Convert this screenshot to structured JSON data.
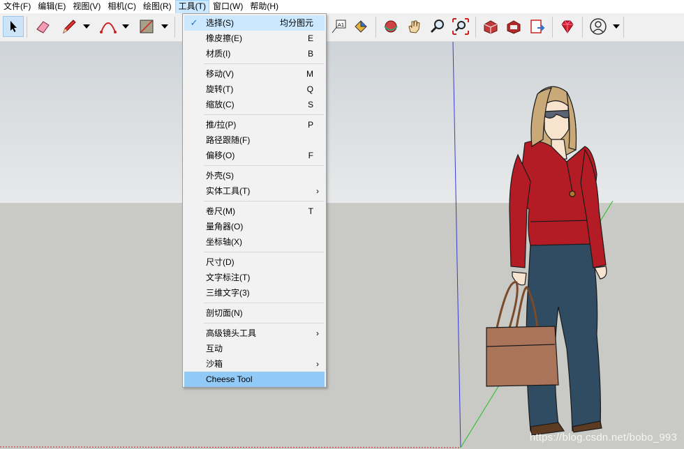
{
  "menubar": {
    "items": [
      {
        "label": "文件(F)"
      },
      {
        "label": "编辑(E)"
      },
      {
        "label": "视图(V)"
      },
      {
        "label": "相机(C)"
      },
      {
        "label": "绘图(R)"
      },
      {
        "label": "工具(T)",
        "active": true
      },
      {
        "label": "窗口(W)"
      },
      {
        "label": "帮助(H)"
      }
    ]
  },
  "toolbar": {
    "icons": [
      "select-arrow-icon",
      "eraser-icon",
      "pencil-icon",
      "arc-icon",
      "rectangle-icon",
      "text-label-icon",
      "paint-bucket-icon",
      "orbit-icon",
      "pan-hand-icon",
      "zoom-magnifier-icon",
      "zoom-extents-icon",
      "warehouse-icon",
      "extension-warehouse-icon",
      "send-to-layout-icon",
      "ruby-icon",
      "account-icon"
    ]
  },
  "tools_menu": {
    "items": [
      {
        "label": "选择(S)",
        "shortcut": "均分图元",
        "checked": true
      },
      {
        "label": "橡皮擦(E)",
        "shortcut": "E"
      },
      {
        "label": "材质(I)",
        "shortcut": "B"
      },
      {
        "label": "移动(V)",
        "shortcut": "M"
      },
      {
        "label": "旋转(T)",
        "shortcut": "Q"
      },
      {
        "label": "缩放(C)",
        "shortcut": "S"
      },
      {
        "label": "推/拉(P)",
        "shortcut": "P"
      },
      {
        "label": "路径跟随(F)",
        "shortcut": ""
      },
      {
        "label": "偏移(O)",
        "shortcut": "F"
      },
      {
        "label": "外壳(S)",
        "shortcut": ""
      },
      {
        "label": "实体工具(T)",
        "shortcut": "",
        "submenu": true
      },
      {
        "label": "卷尺(M)",
        "shortcut": "T"
      },
      {
        "label": "量角器(O)",
        "shortcut": ""
      },
      {
        "label": "坐标轴(X)",
        "shortcut": ""
      },
      {
        "label": "尺寸(D)",
        "shortcut": ""
      },
      {
        "label": "文字标注(T)",
        "shortcut": ""
      },
      {
        "label": "三维文字(3)",
        "shortcut": ""
      },
      {
        "label": "剖切面(N)",
        "shortcut": ""
      },
      {
        "label": "高级镜头工具",
        "shortcut": "",
        "submenu": true
      },
      {
        "label": "互动",
        "shortcut": ""
      },
      {
        "label": "沙箱",
        "shortcut": "",
        "submenu": true
      },
      {
        "label": "Cheese Tool",
        "shortcut": "",
        "highlighted": true
      }
    ],
    "check_mark": "✓",
    "submenu_arrow": "›"
  },
  "viewport": {
    "watermark": "https://blog.csdn.net/bobo_993",
    "colors": {
      "sky_top": "#cfd4d8",
      "ground": "#c9c9c5",
      "blue_axis": "#3a3ad0",
      "green_axis": "#20c020",
      "red_axis": "#d02020"
    }
  }
}
